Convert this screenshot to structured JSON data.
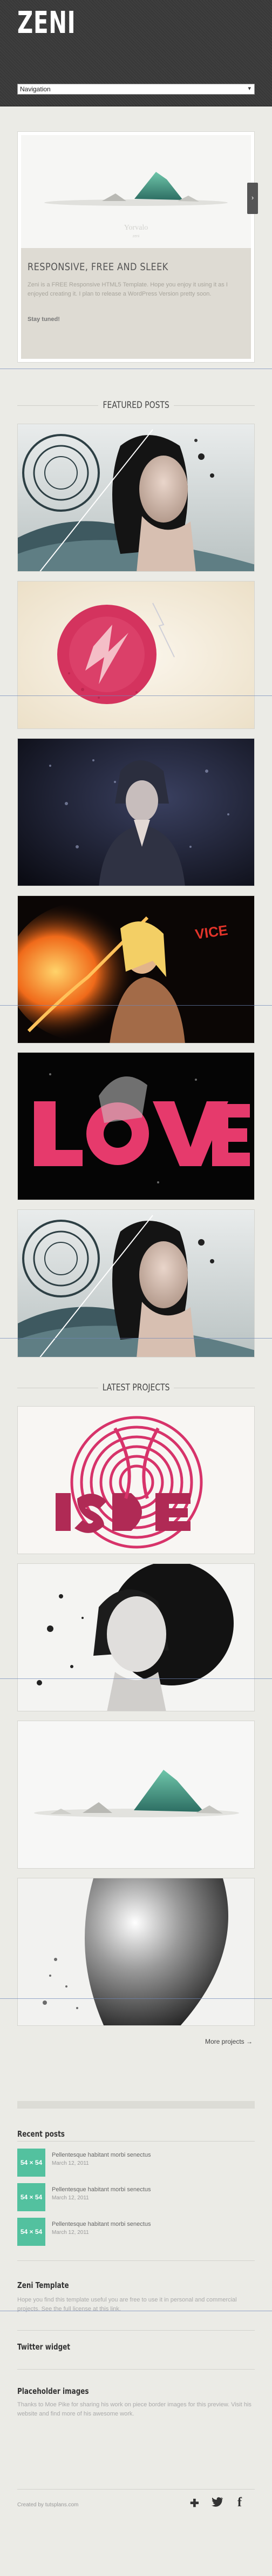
{
  "header": {
    "logo": "ZENI"
  },
  "nav": {
    "selected": "Navigation"
  },
  "slider": {
    "image_caption": "Yorvalo",
    "image_caption_sub": "zeni",
    "title": "RESPONSIVE, FREE AND SLEEK",
    "description": "Zeni is a FREE Responsive HTML5 Template. Hope you enjoy it using it as I enjoyed creating it. I plan to release a WordPress Version pretty soon.",
    "link": "Stay tuned!",
    "next_icon": "chevron-right"
  },
  "featured": {
    "title": "FEATURED POSTS"
  },
  "projects": {
    "title": "LATEST PROJECTS",
    "more_link": "More projects →"
  },
  "recent_posts": {
    "title": "Recent posts",
    "items": [
      {
        "thumb": "54 × 54",
        "title": "Pellentesque habitant morbi senectus",
        "date": "March 12, 2011"
      },
      {
        "thumb": "54 × 54",
        "title": "Pellentesque habitant morbi senectus",
        "date": "March 12, 2011"
      },
      {
        "thumb": "54 × 54",
        "title": "Pellentesque habitant morbi senectus",
        "date": "March 12, 2011"
      }
    ]
  },
  "zeni_template": {
    "title": "Zeni Template",
    "text": "Hope you find this template useful you are free to use it in personal and commercial projects. See the full license at this link."
  },
  "twitter": {
    "title": "Twitter widget"
  },
  "placeholder": {
    "title": "Placeholder images",
    "text": "Thanks to Moe Pike for sharing his work on piece border images for this preview. Visit his website and find more of his awesome work."
  },
  "footer": {
    "credits": "Created by tutsplans.com",
    "social": [
      {
        "icon": "google-plus-icon",
        "glyph": "✚"
      },
      {
        "icon": "twitter-icon",
        "glyph": "🐦"
      },
      {
        "icon": "facebook-icon",
        "glyph": "f"
      }
    ]
  }
}
